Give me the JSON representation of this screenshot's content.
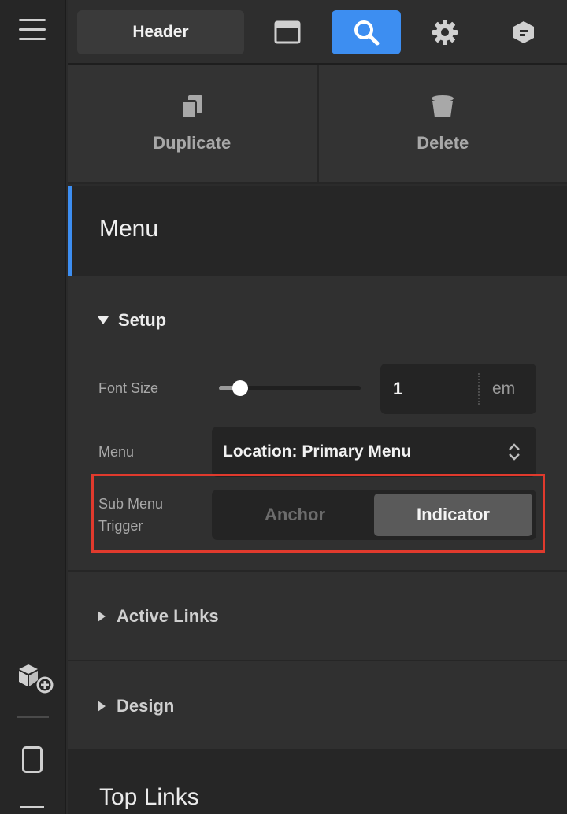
{
  "toolbar": {
    "context_label": "Header",
    "icons": [
      "layout-icon",
      "search-icon",
      "gear-icon",
      "cube-icon"
    ],
    "accent": "#3d8ef1"
  },
  "actions": {
    "duplicate_label": "Duplicate",
    "delete_label": "Delete"
  },
  "element": {
    "title": "Menu"
  },
  "setup": {
    "title": "Setup",
    "font_size": {
      "label": "Font Size",
      "slider_level": 0.15,
      "value": "1",
      "unit": "em"
    },
    "menu": {
      "label": "Menu",
      "selected": "Location: Primary Menu"
    },
    "sub_menu_trigger": {
      "label_line1": "Sub Menu",
      "label_line2": "Trigger",
      "options": [
        "Anchor",
        "Indicator"
      ],
      "selected": "Indicator"
    },
    "highlight_color": "#e03a2d"
  },
  "sections": {
    "active_links": "Active Links",
    "design": "Design"
  },
  "next_element": {
    "title": "Top Links"
  }
}
